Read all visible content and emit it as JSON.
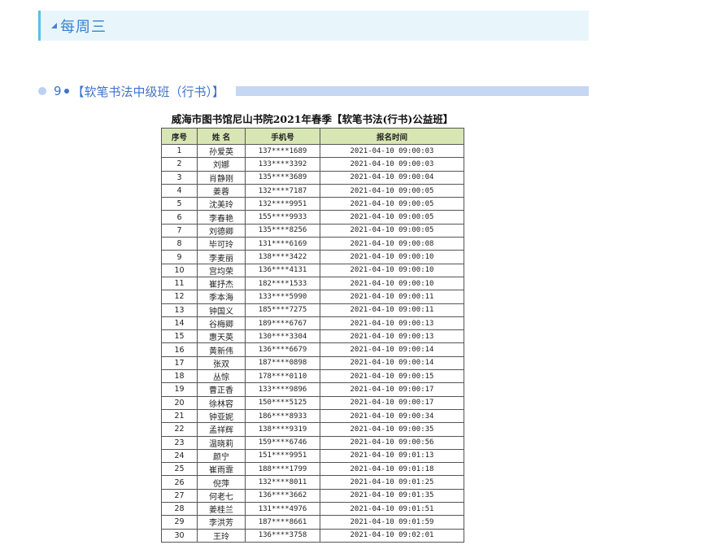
{
  "section": {
    "title": "每周三"
  },
  "class_heading": {
    "number": "9",
    "name": "【软笔书法中级班（行书）】"
  },
  "document": {
    "title": "威海市图书馆尼山书院2021年春季【软笔书法(行书)公益班】",
    "headers": [
      "序号",
      "姓 名",
      "手机号",
      "报名时间"
    ],
    "rows": [
      [
        "1",
        "孙爱英",
        "137****1689",
        "2021-04-10 09:00:03"
      ],
      [
        "2",
        "刘娜",
        "133****3392",
        "2021-04-10 09:00:03"
      ],
      [
        "3",
        "肖静刚",
        "135****3689",
        "2021-04-10 09:00:04"
      ],
      [
        "4",
        "姜蓉",
        "132****7187",
        "2021-04-10 09:00:05"
      ],
      [
        "5",
        "沈美玲",
        "132****9951",
        "2021-04-10 09:00:05"
      ],
      [
        "6",
        "李春艳",
        "155****9933",
        "2021-04-10 09:00:05"
      ],
      [
        "7",
        "刘德卿",
        "135****8256",
        "2021-04-10 09:00:05"
      ],
      [
        "8",
        "毕可玲",
        "131****6169",
        "2021-04-10 09:00:08"
      ],
      [
        "9",
        "李麦丽",
        "138****3422",
        "2021-04-10 09:00:10"
      ],
      [
        "10",
        "宫均荣",
        "136****4131",
        "2021-04-10 09:00:10"
      ],
      [
        "11",
        "崔抒杰",
        "182****1533",
        "2021-04-10 09:00:10"
      ],
      [
        "12",
        "季本海",
        "133****5990",
        "2021-04-10 09:00:11"
      ],
      [
        "13",
        "钟国义",
        "185****7275",
        "2021-04-10 09:00:11"
      ],
      [
        "14",
        "谷梅卿",
        "189****6767",
        "2021-04-10 09:00:13"
      ],
      [
        "15",
        "惠天英",
        "130****3304",
        "2021-04-10 09:00:13"
      ],
      [
        "16",
        "黄新伟",
        "136****6679",
        "2021-04-10 09:00:14"
      ],
      [
        "17",
        "张双",
        "187****0898",
        "2021-04-10 09:00:14"
      ],
      [
        "18",
        "丛悰",
        "178****0110",
        "2021-04-10 09:00:15"
      ],
      [
        "19",
        "曹正香",
        "133****9896",
        "2021-04-10 09:00:17"
      ],
      [
        "20",
        "徐林容",
        "150****5125",
        "2021-04-10 09:00:17"
      ],
      [
        "21",
        "钟亚妮",
        "186****8933",
        "2021-04-10 09:00:34"
      ],
      [
        "22",
        "孟祥辉",
        "138****9319",
        "2021-04-10 09:00:35"
      ],
      [
        "23",
        "温晓莉",
        "159****6746",
        "2021-04-10 09:00:56"
      ],
      [
        "24",
        "颜宁",
        "151****9951",
        "2021-04-10 09:01:13"
      ],
      [
        "25",
        "崔雨霏",
        "188****1799",
        "2021-04-10 09:01:18"
      ],
      [
        "26",
        "倪萍",
        "132****8011",
        "2021-04-10 09:01:25"
      ],
      [
        "27",
        "何老七",
        "136****3662",
        "2021-04-10 09:01:35"
      ],
      [
        "28",
        "姜桂兰",
        "131****4976",
        "2021-04-10 09:01:51"
      ],
      [
        "29",
        "李洪芳",
        "187****8661",
        "2021-04-10 09:01:59"
      ],
      [
        "30",
        "王玲",
        "136****3758",
        "2021-04-10 09:02:01"
      ]
    ]
  }
}
